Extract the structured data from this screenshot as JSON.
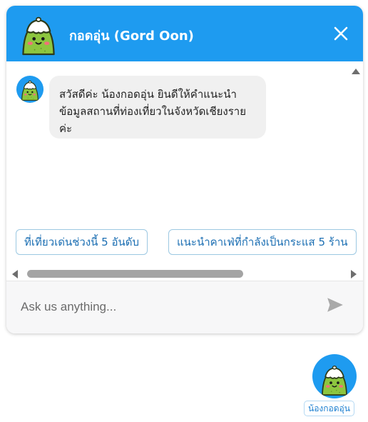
{
  "header": {
    "title": "กอดอุ่น (Gord Oon)",
    "avatar_icon": "gord-oon-mascot-icon",
    "close_icon": "close-icon",
    "background_color": "#1e9bf0"
  },
  "messages": [
    {
      "sender": "bot",
      "text": "สวัสดีค่ะ น้องกอดอุ่น ยินดีให้คำแนะนำข้อมูลสถานที่ท่องเที่ยวในจังหวัดเชียงรายค่ะ"
    }
  ],
  "quick_replies": [
    {
      "label": "ที่เที่ยวเด่นช่วงนี้ 5 อันดับ"
    },
    {
      "label": "แนะนำคาเฟ่ที่กำลังเป็นกระแส 5 ร้าน"
    }
  ],
  "input": {
    "placeholder": "Ask us anything...",
    "value": ""
  },
  "send_icon": "send-icon",
  "launcher": {
    "label": "น้องกอดอุ่น",
    "icon": "gord-oon-mascot-icon"
  }
}
